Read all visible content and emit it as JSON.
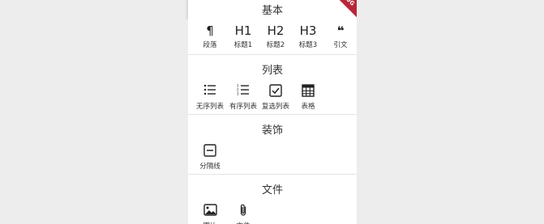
{
  "debug_banner": "BUG",
  "sections": [
    {
      "title": "基本",
      "items": [
        {
          "icon": "¶",
          "label": "段落"
        },
        {
          "icon": "H1",
          "label": "标题1"
        },
        {
          "icon": "H2",
          "label": "标题2"
        },
        {
          "icon": "H3",
          "label": "标题3"
        },
        {
          "icon": "❝",
          "label": "引文"
        }
      ]
    },
    {
      "title": "列表",
      "items": [
        {
          "icon": "bulleted-list-icon",
          "label": "无序列表"
        },
        {
          "icon": "numbered-list-icon",
          "label": "有序列表"
        },
        {
          "icon": "checkbox-icon",
          "label": "复选列表"
        },
        {
          "icon": "table-icon",
          "label": "表格"
        }
      ]
    },
    {
      "title": "装饰",
      "items": [
        {
          "icon": "divider-icon",
          "label": "分隔线"
        }
      ]
    },
    {
      "title": "文件",
      "items": [
        {
          "icon": "image-icon",
          "label": "图片"
        },
        {
          "icon": "paperclip-icon",
          "label": "文件"
        }
      ]
    }
  ]
}
